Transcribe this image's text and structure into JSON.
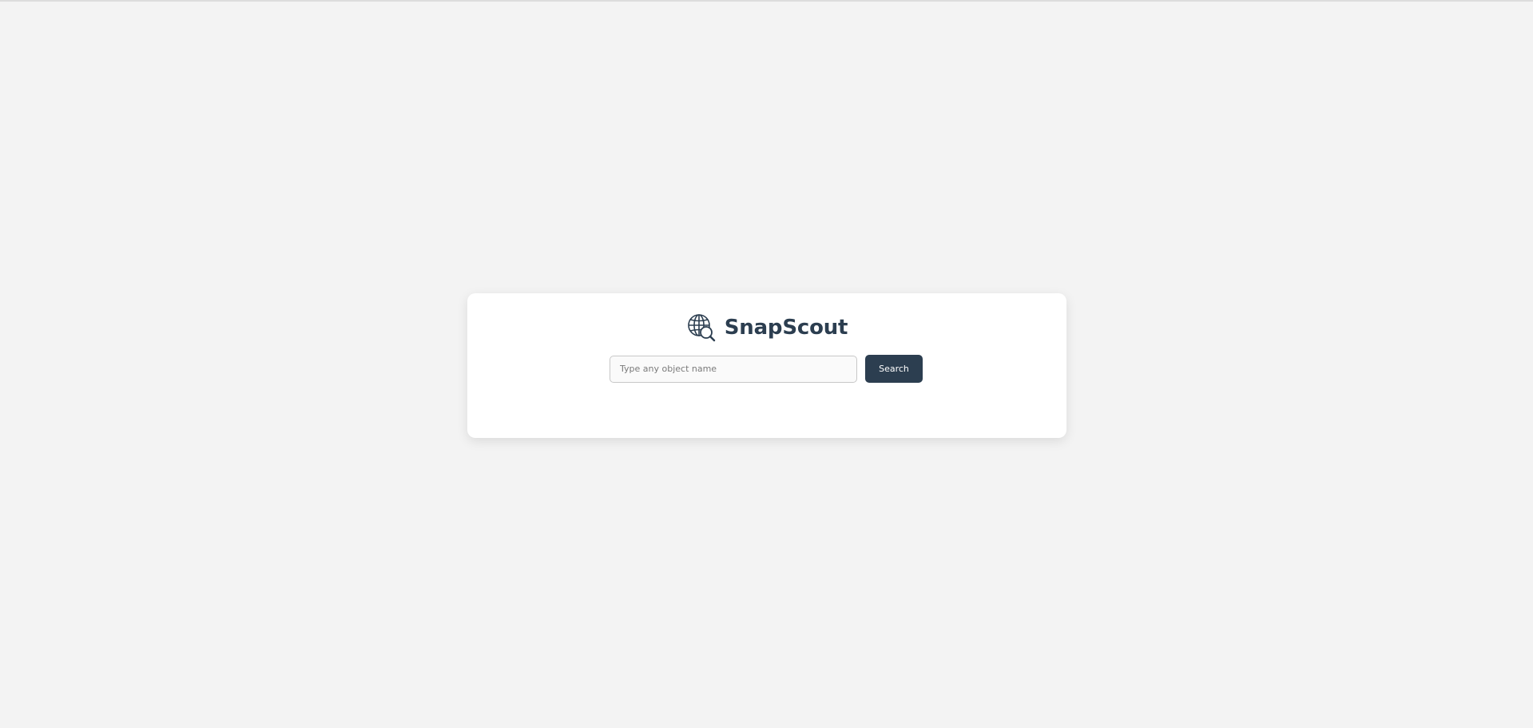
{
  "app": {
    "title": "SnapScout",
    "logo_icon": "globe-search-icon"
  },
  "search": {
    "placeholder": "Type any object name",
    "value": "",
    "button_label": "Search"
  },
  "colors": {
    "background": "#f3f3f3",
    "card": "#ffffff",
    "primary": "#2c3e50"
  }
}
